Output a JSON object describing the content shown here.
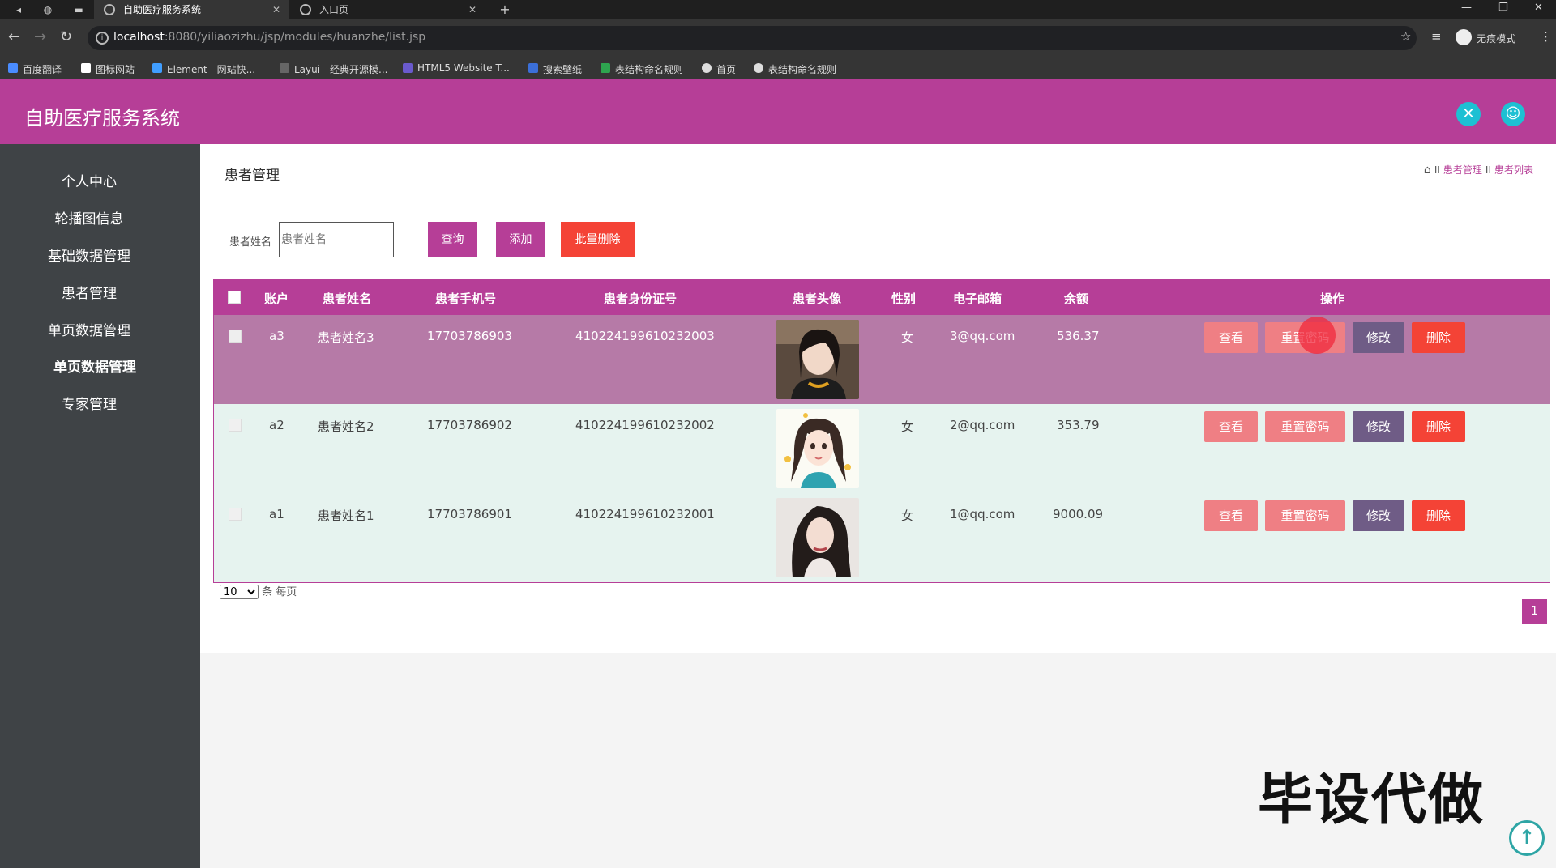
{
  "browser": {
    "tabs": [
      {
        "title": "自助医疗服务系统"
      },
      {
        "title": "入口页"
      }
    ],
    "url_host": "localhost",
    "url_path": ":8080/yiliaozizhu/jsp/modules/huanzhe/list.jsp",
    "incognito_label": "无痕模式",
    "bookmarks": [
      "百度翻译",
      "图标网站",
      "Element - 网站快...",
      "Layui - 经典开源模...",
      "HTML5 Website T...",
      "搜索壁纸",
      "表结构命名规则",
      "首页",
      "表结构命名规则"
    ]
  },
  "app": {
    "title": "自助医疗服务系统"
  },
  "sidebar": {
    "items": [
      "个人中心",
      "轮播图信息",
      "基础数据管理",
      "患者管理",
      "单页数据管理",
      "单页数据管理",
      "专家管理"
    ]
  },
  "page": {
    "title": "患者管理",
    "breadcrumb": [
      "患者管理",
      "患者列表"
    ]
  },
  "search": {
    "label": "患者姓名",
    "placeholder": "患者姓名",
    "query_label": "查询",
    "add_label": "添加",
    "batch_delete_label": "批量删除"
  },
  "table": {
    "headers": [
      "账户",
      "患者姓名",
      "患者手机号",
      "患者身份证号",
      "患者头像",
      "性别",
      "电子邮箱",
      "余额",
      "操作"
    ],
    "rows": [
      {
        "account": "a3",
        "name": "患者姓名3",
        "phone": "17703786903",
        "id_card": "410224199610232003",
        "gender": "女",
        "email": "3@qq.com",
        "balance": "536.37"
      },
      {
        "account": "a2",
        "name": "患者姓名2",
        "phone": "17703786902",
        "id_card": "410224199610232002",
        "gender": "女",
        "email": "2@qq.com",
        "balance": "353.79"
      },
      {
        "account": "a1",
        "name": "患者姓名1",
        "phone": "17703786901",
        "id_card": "410224199610232001",
        "gender": "女",
        "email": "1@qq.com",
        "balance": "9000.09"
      }
    ],
    "actions": {
      "view": "查看",
      "reset": "重置密码",
      "edit": "修改",
      "delete": "删除"
    }
  },
  "pagination": {
    "page_size": "10",
    "page_size_suffix": "条 每页",
    "current_page": "1"
  },
  "overlay": {
    "watermark": "毕设代做"
  },
  "colors": {
    "primary": "#b63e97",
    "danger": "#f44336",
    "accent": "#1ec0d3",
    "sidebar": "#3f4346"
  }
}
